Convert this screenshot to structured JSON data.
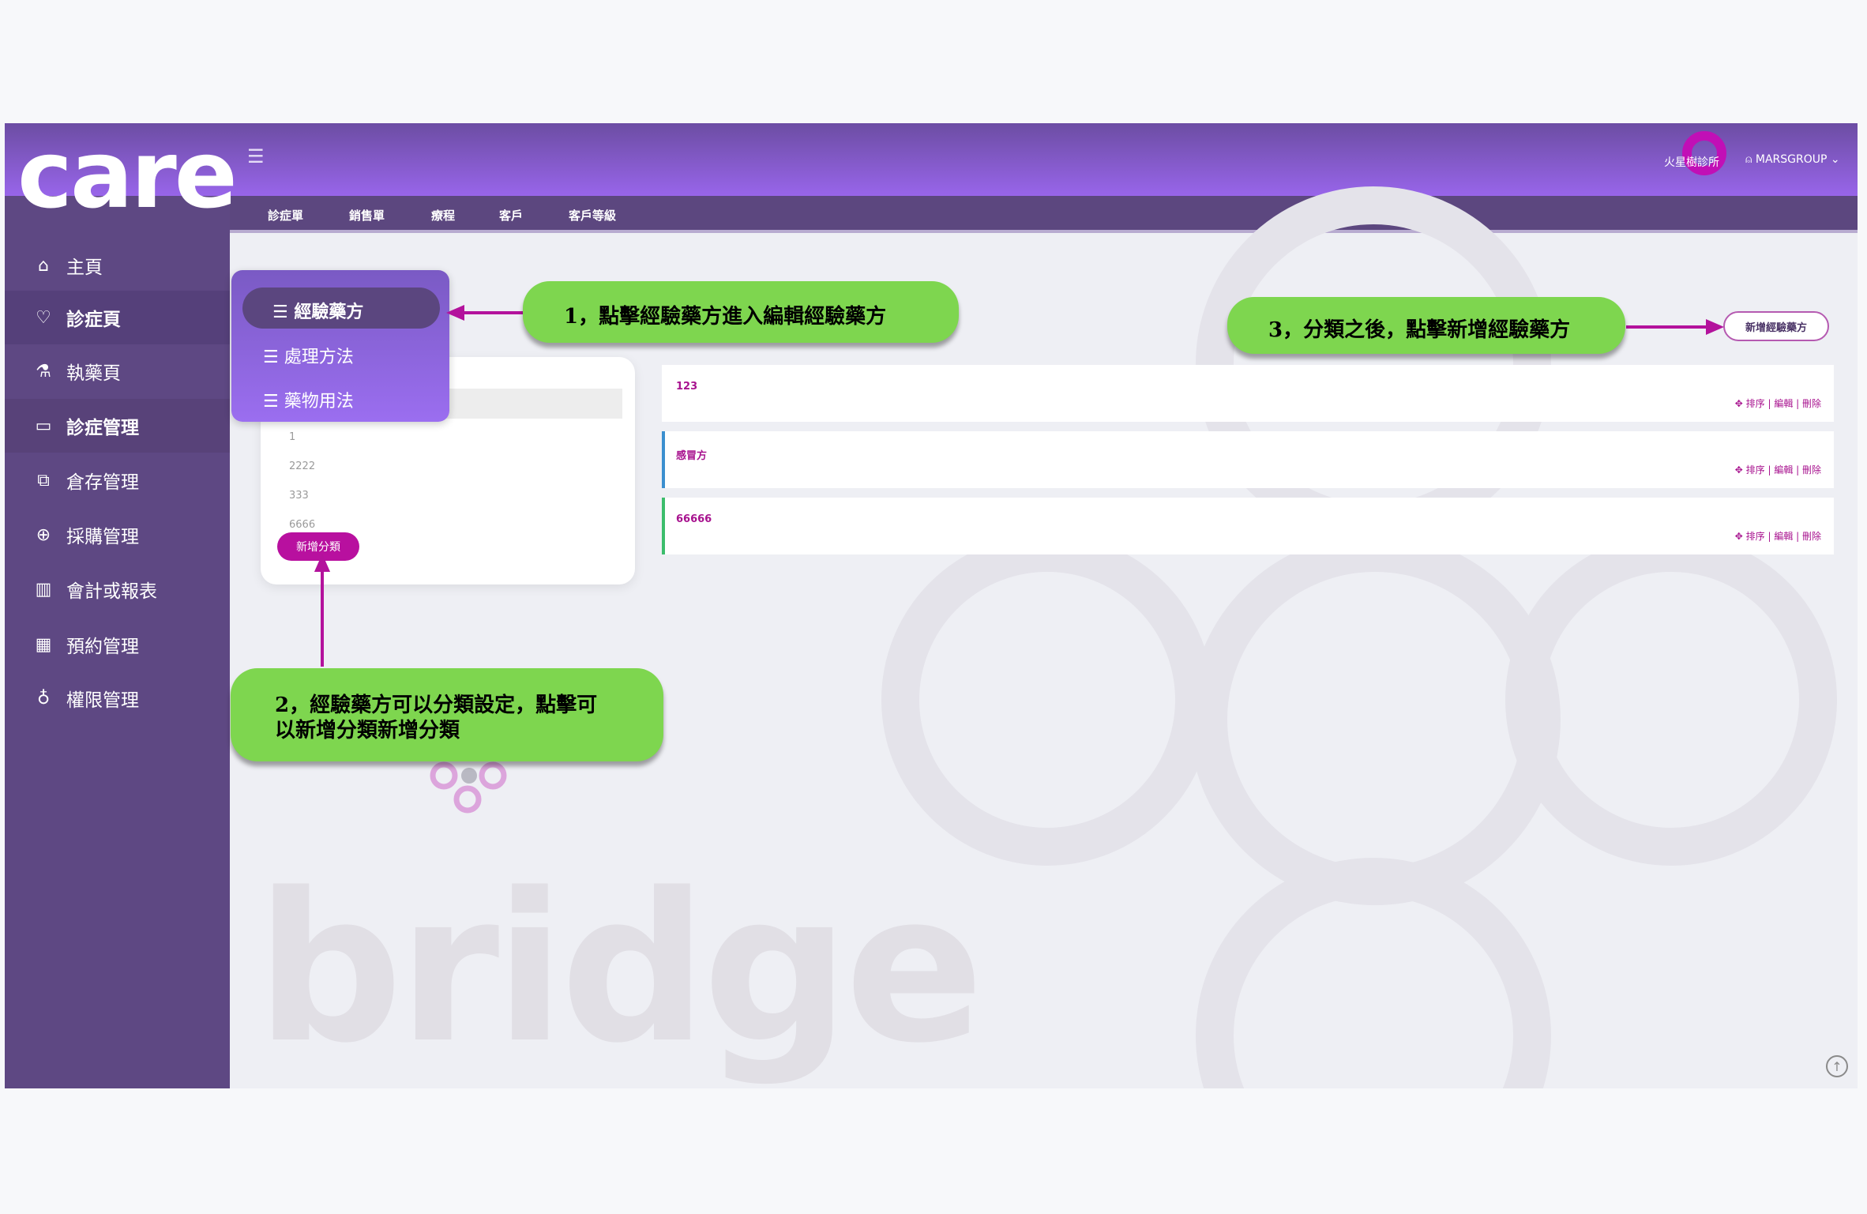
{
  "app": {
    "logo": "care",
    "clinic_name": "火星樹診所",
    "user_name": "MARSGROUP"
  },
  "sidebar": {
    "items": [
      {
        "label": "主頁",
        "icon": "home-icon"
      },
      {
        "label": "診症頁",
        "icon": "heart-icon"
      },
      {
        "label": "執藥頁",
        "icon": "pestle-icon"
      },
      {
        "label": "診症管理",
        "icon": "card-icon"
      },
      {
        "label": "倉存管理",
        "icon": "boxes-icon"
      },
      {
        "label": "採購管理",
        "icon": "plus-circle-icon"
      },
      {
        "label": "會計或報表",
        "icon": "bar-chart-icon"
      },
      {
        "label": "預約管理",
        "icon": "calendar-icon"
      },
      {
        "label": "權限管理",
        "icon": "bulb-icon"
      }
    ]
  },
  "subnav": {
    "tabs": [
      "診症單",
      "銷售單",
      "療程",
      "客戶",
      "客戶等級"
    ]
  },
  "dropdown": {
    "items": [
      "經驗藥方",
      "處理方法",
      "藥物用法"
    ]
  },
  "categories": {
    "items": [
      "1",
      "2222",
      "333",
      "6666"
    ],
    "add_label": "新增分類"
  },
  "prescriptions": {
    "add_label": "新增經驗藥方",
    "items": [
      {
        "name": "123",
        "bar_color": "#ffffff"
      },
      {
        "name": "感冒方",
        "bar_color": "#3b8fcf"
      },
      {
        "name": "66666",
        "bar_color": "#3cbd6c"
      }
    ],
    "actions": "✥ 排序 | 編輯 | 刪除"
  },
  "callouts": {
    "c1": "1，點擊經驗藥方進入編輯經驗藥方",
    "c2_line1": "2，經驗藥方可以分類設定，點擊可",
    "c2_line2": "以新增分類新增分類",
    "c3": "3，分類之後，點擊新增經驗藥方"
  },
  "background": {
    "watermark": "bridge"
  }
}
